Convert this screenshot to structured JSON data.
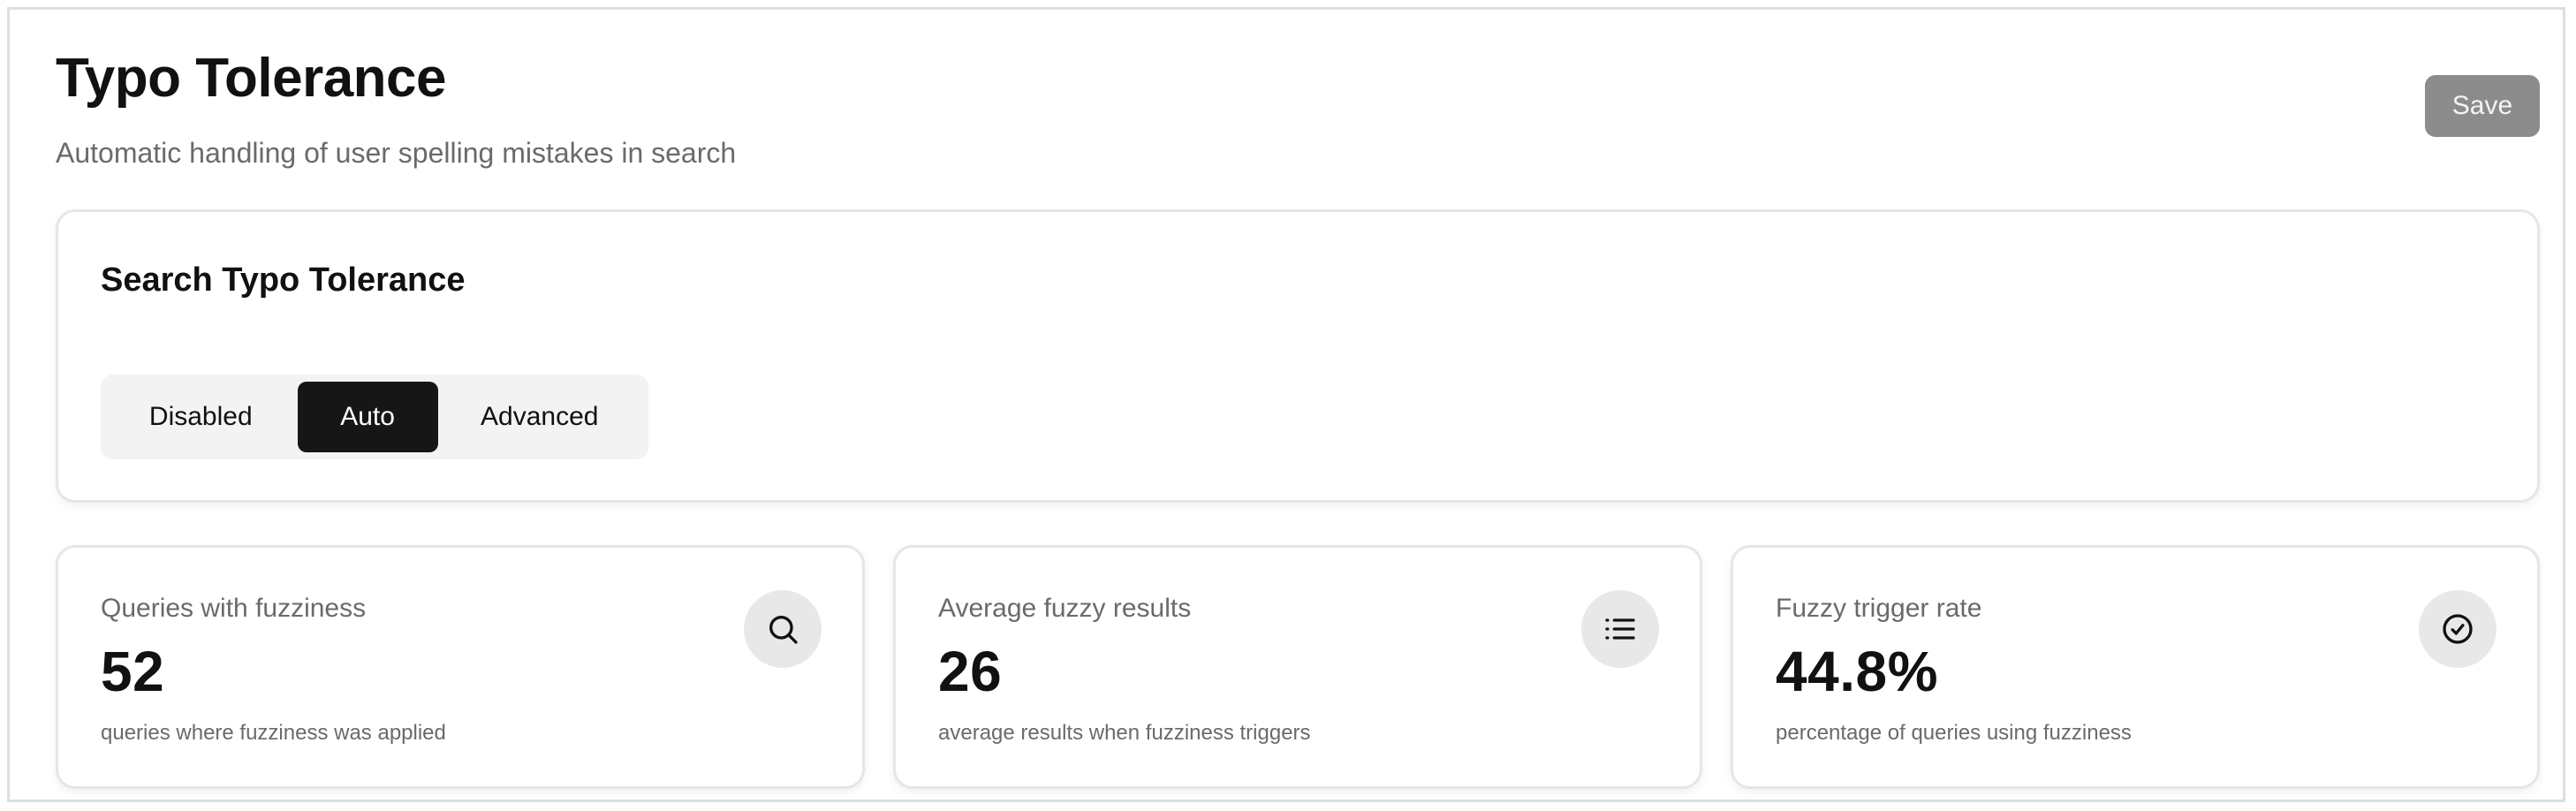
{
  "header": {
    "title": "Typo Tolerance",
    "subtitle": "Automatic handling of user spelling mistakes in search",
    "save_label": "Save"
  },
  "tolerance_panel": {
    "title": "Search Typo Tolerance",
    "options": [
      "Disabled",
      "Auto",
      "Advanced"
    ],
    "selected": "Auto"
  },
  "stats": [
    {
      "label": "Queries with fuzziness",
      "value": "52",
      "caption": "queries where fuzziness was applied",
      "icon": "search-icon"
    },
    {
      "label": "Average fuzzy results",
      "value": "26",
      "caption": "average results when fuzziness triggers",
      "icon": "list-icon"
    },
    {
      "label": "Fuzzy trigger rate",
      "value": "44.8%",
      "caption": "percentage of queries using fuzziness",
      "icon": "check-circle-icon"
    }
  ],
  "colors": {
    "selected_segment": "#161616",
    "save_button": "#8c8c8c",
    "muted_text": "#6a6a6a"
  }
}
